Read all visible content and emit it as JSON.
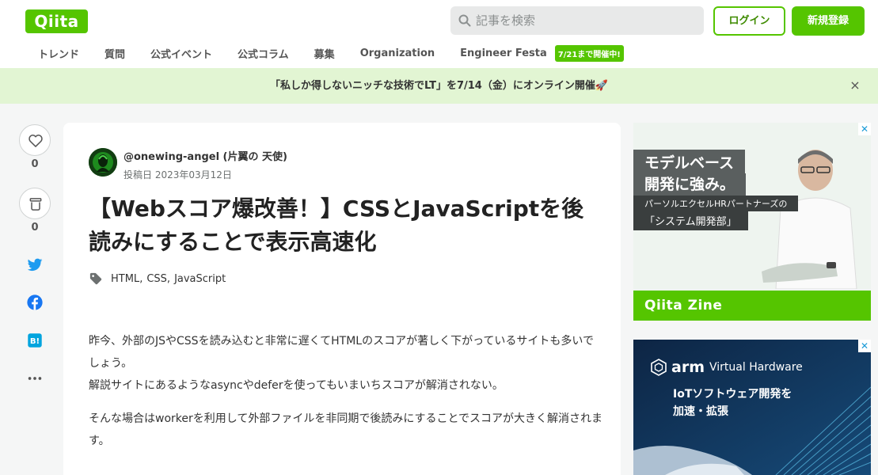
{
  "header": {
    "logo": "Qiita",
    "search_placeholder": "記事を検索",
    "login_label": "ログイン",
    "signup_label": "新規登録"
  },
  "nav": {
    "items": [
      "トレンド",
      "質問",
      "公式イベント",
      "公式コラム",
      "募集",
      "Organization",
      "Engineer Festa"
    ],
    "badge": "7/21まで開催中!"
  },
  "banner": {
    "text": "「私しか得しないニッチな技術でLT」を7/14（金）にオンライン開催🚀",
    "close": "×"
  },
  "rail": {
    "like_count": "0",
    "stock_count": "0",
    "icons": [
      "heart-icon",
      "stock-icon",
      "twitter-icon",
      "facebook-icon",
      "hatena-bookmark-icon",
      "more-icon"
    ]
  },
  "article": {
    "author": "@onewing-angel (片翼の 天使)",
    "posted": "投稿日 2023年03月12日",
    "title": "【Webスコア爆改善！】CSSとJavaScriptを後読みにすることで表示高速化",
    "tags": [
      "HTML",
      "CSS",
      "JavaScript"
    ],
    "paragraphs": [
      "昨今、外部のJSやCSSを読み込むと非常に遅くてHTMLのスコアが著しく下がっているサイトも多いでしょう。",
      "解説サイトにあるようなasyncやdeferを使ってもいまいちスコアが解消されない。",
      "そんな場合はworkerを利用して外部ファイルを非同期で後読みにすることでスコアが大きく解消されます。"
    ]
  },
  "ads": {
    "ad1": {
      "headline1": "モデルベース",
      "headline2": "開発に強み。",
      "sub1": "パーソルエクセルHRパートナーズの",
      "sub2": "「システム開発部」",
      "footer": "Qiita Zine"
    },
    "ad2": {
      "brand": "arm",
      "brand_sub": "Virtual Hardware",
      "line1": "IoTソフトウェア開発を",
      "line2": "加速・拡張"
    },
    "close": "✕"
  },
  "colors": {
    "brand_green": "#55c500",
    "banner_bg": "#e2f5d3",
    "page_bg": "#f5f6f6",
    "twitter": "#1d9bf0",
    "facebook": "#1877f2",
    "hatena": "#00a4de"
  }
}
